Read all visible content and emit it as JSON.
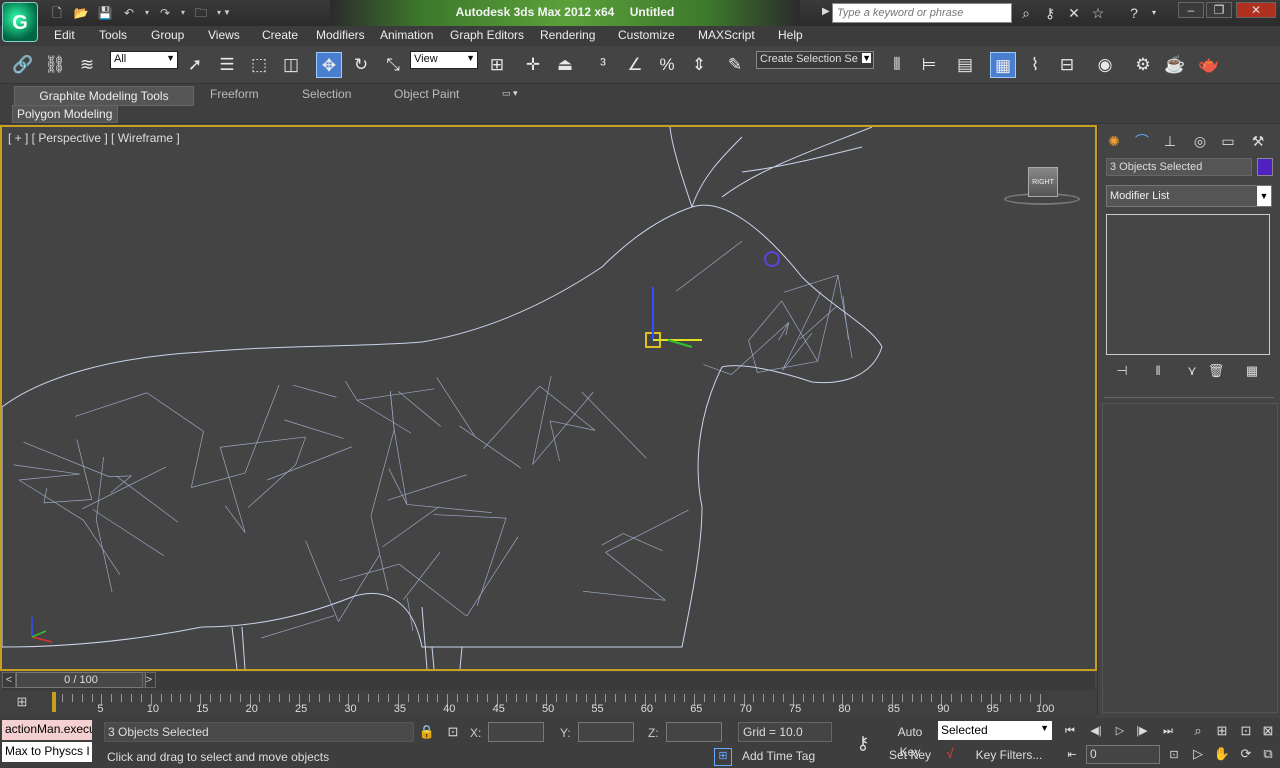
{
  "titlebar": {
    "app_name": "Autodesk 3ds Max  2012 x64",
    "doc_name": "Untitled",
    "search_placeholder": "Type a keyword or phrase"
  },
  "menu": [
    "Edit",
    "Tools",
    "Group",
    "Views",
    "Create",
    "Modifiers",
    "Animation",
    "Graph Editors",
    "Rendering",
    "Customize",
    "MAXScript",
    "Help"
  ],
  "toolbar": {
    "selection_filter": "All",
    "ref_coord": "View",
    "named_selection_placeholder": "Create Selection Se"
  },
  "ribbon": {
    "tabs": [
      "Graphite Modeling Tools",
      "Freeform",
      "Selection",
      "Object Paint"
    ],
    "panel_label": "Polygon Modeling"
  },
  "viewport": {
    "label": "[ + ] [ Perspective ] [ Wireframe ]",
    "viewcube_label": "RIGHT"
  },
  "command_panel": {
    "object_name": "3 Objects Selected",
    "object_color": "#5020c0",
    "modifier_list": "Modifier List"
  },
  "timeslider": {
    "position": "0 / 100",
    "prev": "<",
    "next": ">"
  },
  "trackbar": {
    "labels": [
      "5",
      "10",
      "15",
      "20",
      "25",
      "30",
      "35",
      "40",
      "45",
      "50",
      "55",
      "60",
      "65",
      "70",
      "75",
      "80",
      "85",
      "90",
      "95",
      "100"
    ]
  },
  "status": {
    "maxscript_line1": "actionMan.execu",
    "maxscript_line2": "Max to Physcs I",
    "selection_count": "3 Objects Selected",
    "x_label": "X:",
    "y_label": "Y:",
    "z_label": "Z:",
    "grid": "Grid = 10.0",
    "prompt": "Click and drag to select and move objects",
    "add_time_tag": "Add Time Tag",
    "auto_key": "Auto Key",
    "set_key": "Set Key",
    "key_mode": "Selected",
    "key_filters": "Key Filters...",
    "current_frame": "0"
  }
}
